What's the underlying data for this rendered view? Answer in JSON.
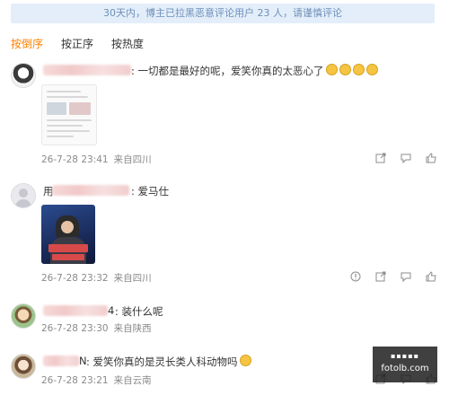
{
  "notice": "30天内，博主已拉黑恶意评论用户 23 人，请谨慎评论",
  "sort_tabs": [
    {
      "label": "按倒序",
      "active": true
    },
    {
      "label": "按正序",
      "active": false
    },
    {
      "label": "按热度",
      "active": false
    }
  ],
  "comments": [
    {
      "name_visible": "",
      "text": ": 一切都是最好的呢，爱笑你真的太恶心了",
      "emoji_count": 4,
      "time": "26-7-28 23:41",
      "location": "来自四川",
      "actions": [
        "share-icon",
        "comment-icon",
        "like-icon"
      ]
    },
    {
      "name_visible": "用",
      "text": ": 爱马仕",
      "time": "26-7-28 23:32",
      "location": "来自四川",
      "actions": [
        "report-icon",
        "share-icon",
        "comment-icon",
        "like-icon"
      ]
    },
    {
      "name_visible": "4",
      "text": ": 装什么呢",
      "time": "26-7-28 23:30",
      "location": "来自陕西",
      "actions": []
    },
    {
      "name_visible": "N",
      "text": ": 爱笑你真的是灵长类人科动物吗",
      "time": "26-7-28 23:21",
      "location": "来自云南",
      "actions": [
        "share-icon",
        "comment-icon",
        "like-icon"
      ]
    }
  ],
  "watermark": {
    "top": "▪▪▪▪▪",
    "site": "fotolb.com"
  }
}
